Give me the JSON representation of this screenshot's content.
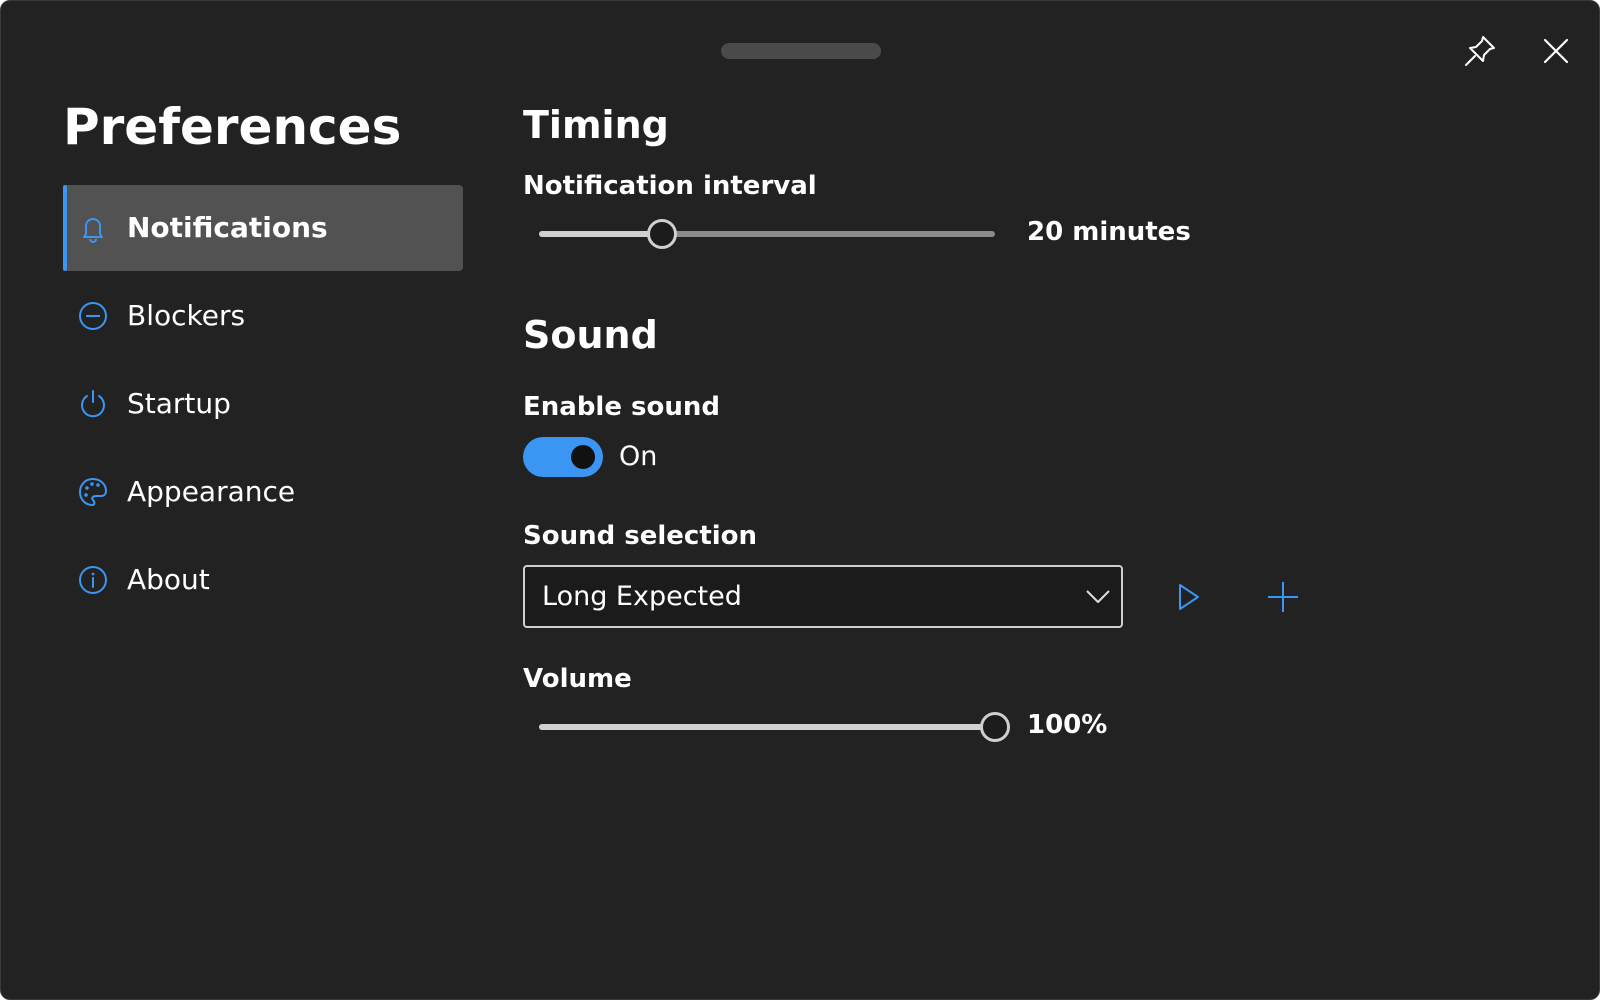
{
  "window": {
    "pin_icon": "pin-icon",
    "close_icon": "close-icon"
  },
  "sidebar": {
    "title": "Preferences",
    "items": [
      {
        "label": "Notifications",
        "icon": "bell-icon",
        "selected": true
      },
      {
        "label": "Blockers",
        "icon": "minus-circle-icon",
        "selected": false
      },
      {
        "label": "Startup",
        "icon": "power-icon",
        "selected": false
      },
      {
        "label": "Appearance",
        "icon": "palette-icon",
        "selected": false
      },
      {
        "label": "About",
        "icon": "info-icon",
        "selected": false
      }
    ]
  },
  "timing": {
    "title": "Timing",
    "interval_label": "Notification interval",
    "interval_value": "20 minutes",
    "interval_fraction": 0.27
  },
  "sound": {
    "title": "Sound",
    "enable_label": "Enable sound",
    "enable_state": "On",
    "enabled": true,
    "selection_label": "Sound selection",
    "selection_value": "Long Expected",
    "volume_label": "Volume",
    "volume_value": "100%",
    "volume_fraction": 1.0
  },
  "colors": {
    "accent": "#3a96f2",
    "background": "#222222",
    "selected_item": "#525252"
  }
}
